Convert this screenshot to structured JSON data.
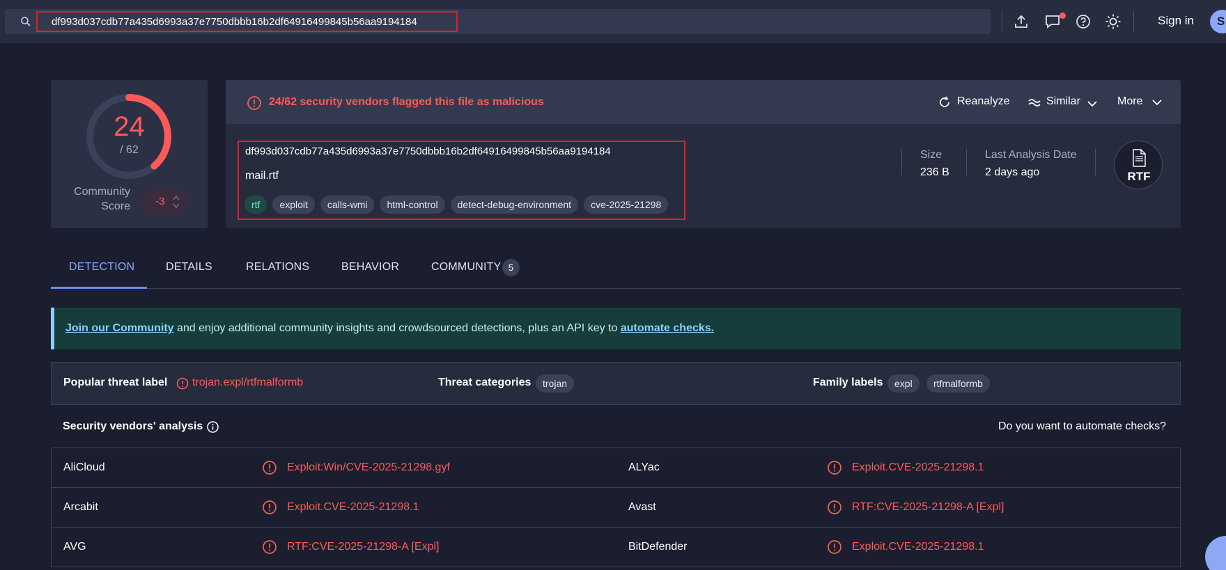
{
  "search": {
    "value": "df993d037cdb77a435d6993a37e7750dbbb16b2df64916499845b56aa9194184"
  },
  "topbar": {
    "signin": "Sign in",
    "avatar_letter": "S"
  },
  "score": {
    "detections": "24",
    "total": "/ 62",
    "fraction": 0.387,
    "community_label": "Community Score",
    "community_value": "-3"
  },
  "alert": {
    "text": "24/62 security vendors flagged this file as malicious"
  },
  "actions": {
    "reanalyze": "Reanalyze",
    "similar": "Similar",
    "more": "More"
  },
  "file": {
    "hash": "df993d037cdb77a435d6993a37e7750dbbb16b2df64916499845b56aa9194184",
    "name": "mail.rtf",
    "tags": [
      "rtf",
      "exploit",
      "calls-wmi",
      "html-control",
      "detect-debug-environment",
      "cve-2025-21298"
    ],
    "size_label": "Size",
    "size": "236 B",
    "date_label": "Last Analysis Date",
    "date": "2 days ago",
    "type": "RTF"
  },
  "tabs": [
    {
      "label": "DETECTION"
    },
    {
      "label": "DETAILS"
    },
    {
      "label": "RELATIONS"
    },
    {
      "label": "BEHAVIOR"
    },
    {
      "label": "COMMUNITY"
    }
  ],
  "community_count": "5",
  "banner": {
    "link1": "Join our Community",
    "text": " and enjoy additional community insights and crowdsourced detections, plus an API key to ",
    "link2": "automate checks."
  },
  "threat": {
    "popular_label": "Popular threat label",
    "popular_value": "trojan.expl/rtfmalformb",
    "categories_label": "Threat categories",
    "categories": [
      "trojan"
    ],
    "family_label": "Family labels",
    "families": [
      "expl",
      "rtfmalformb"
    ]
  },
  "vendors": {
    "title": "Security vendors' analysis",
    "automate_question": "Do you want to automate checks?",
    "rows": [
      {
        "left_name": "AliCloud",
        "left_result": "Exploit:Win/CVE-2025-21298.gyf",
        "right_name": "ALYac",
        "right_result": "Exploit.CVE-2025-21298.1"
      },
      {
        "left_name": "Arcabit",
        "left_result": "Exploit.CVE-2025-21298.1",
        "right_name": "Avast",
        "right_result": "RTF:CVE-2025-21298-A [Expl]"
      },
      {
        "left_name": "AVG",
        "left_result": "RTF:CVE-2025-21298-A [Expl]",
        "right_name": "BitDefender",
        "right_result": "Exploit.CVE-2025-21298.1"
      }
    ]
  },
  "colors": {
    "malicious": "#ff5a5a",
    "accent": "#8aa9ff",
    "banner_bg": "#163d3b"
  }
}
